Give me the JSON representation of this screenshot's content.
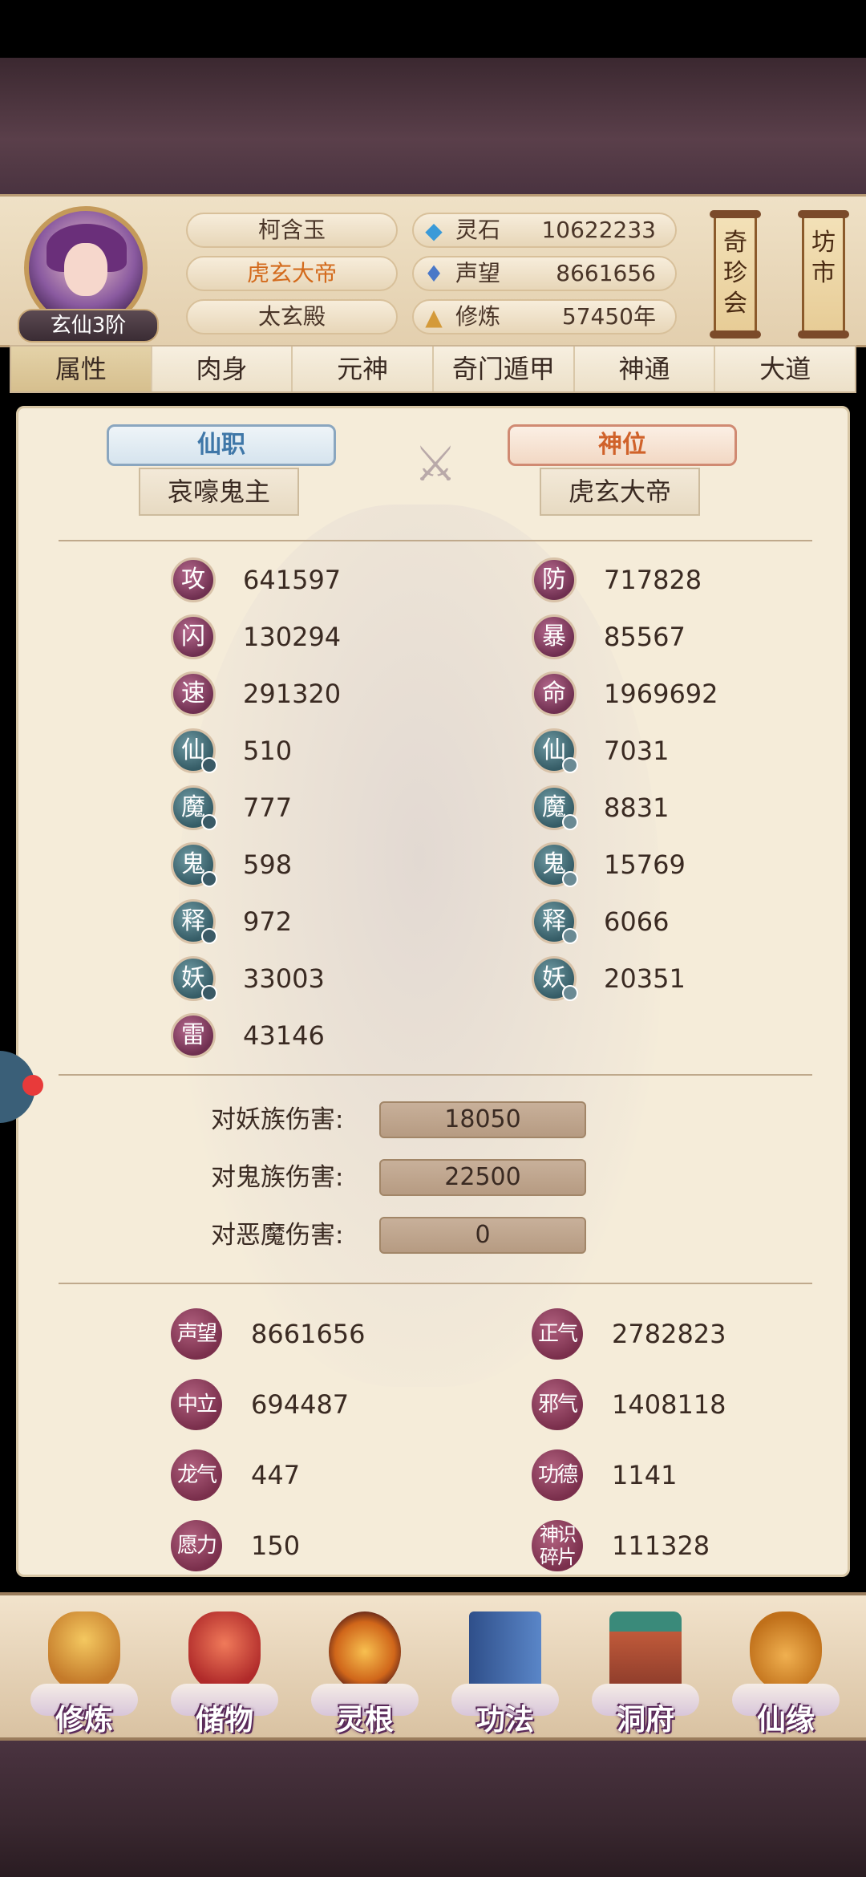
{
  "header": {
    "rank": "玄仙3阶",
    "name": "柯含玉",
    "title": "虎玄大帝",
    "sect": "太玄殿",
    "resources": [
      {
        "icon": "spirit-stone-icon",
        "label": "灵石",
        "value": "10622233"
      },
      {
        "icon": "prestige-crystal-icon",
        "label": "声望",
        "value": "8661656"
      },
      {
        "icon": "meditation-icon",
        "label": "修炼",
        "value": "57450年"
      }
    ],
    "scroll_left": "奇珍会",
    "scroll_right": "坊市"
  },
  "tabs": [
    {
      "label": "属性",
      "active": true
    },
    {
      "label": "肉身"
    },
    {
      "label": "元神"
    },
    {
      "label": "奇门遁甲"
    },
    {
      "label": "神通"
    },
    {
      "label": "大道"
    }
  ],
  "positions": {
    "left_banner": "仙职",
    "left_value": "哀嚎鬼主",
    "right_banner": "神位",
    "right_value": "虎玄大帝"
  },
  "stats_left": [
    {
      "glyph": "攻",
      "value": "641597"
    },
    {
      "glyph": "闪",
      "value": "130294"
    },
    {
      "glyph": "速",
      "value": "291320"
    },
    {
      "glyph": "仙",
      "value": "510"
    },
    {
      "glyph": "魔",
      "value": "777"
    },
    {
      "glyph": "鬼",
      "value": "598"
    },
    {
      "glyph": "释",
      "value": "972"
    },
    {
      "glyph": "妖",
      "value": "33003"
    },
    {
      "glyph": "雷",
      "value": "43146"
    }
  ],
  "stats_right": [
    {
      "glyph": "防",
      "value": "717828"
    },
    {
      "glyph": "暴",
      "value": "85567"
    },
    {
      "glyph": "命",
      "value": "1969692"
    },
    {
      "glyph": "仙",
      "value": "7031"
    },
    {
      "glyph": "魔",
      "value": "8831"
    },
    {
      "glyph": "鬼",
      "value": "15769"
    },
    {
      "glyph": "释",
      "value": "6066"
    },
    {
      "glyph": "妖",
      "value": "20351"
    }
  ],
  "damage": [
    {
      "label": "对妖族伤害:",
      "value": "18050"
    },
    {
      "label": "对鬼族伤害:",
      "value": "22500"
    },
    {
      "label": "对恶魔伤害:",
      "value": "0"
    }
  ],
  "misc_left": [
    {
      "glyph": "声望",
      "value": "8661656"
    },
    {
      "glyph": "中立",
      "value": "694487"
    },
    {
      "glyph": "龙气",
      "value": "447"
    },
    {
      "glyph": "愿力",
      "value": "150"
    }
  ],
  "misc_right": [
    {
      "glyph": "正气",
      "value": "2782823"
    },
    {
      "glyph": "邪气",
      "value": "1408118"
    },
    {
      "glyph": "功德",
      "value": "1141"
    },
    {
      "glyph": "神识碎片",
      "value": "111328"
    }
  ],
  "nav": [
    {
      "label": "修炼",
      "icon": "meditation-icon",
      "color": "#e0a040"
    },
    {
      "label": "储物",
      "icon": "storage-bag-icon",
      "color": "#d0482e"
    },
    {
      "label": "灵根",
      "icon": "spirit-root-icon",
      "color": "#e07a18"
    },
    {
      "label": "功法",
      "icon": "book-icon",
      "color": "#3f6aa8"
    },
    {
      "label": "洞府",
      "icon": "cave-house-icon",
      "color": "#b0503a"
    },
    {
      "label": "仙缘",
      "icon": "gourd-icon",
      "color": "#d08a2a"
    }
  ],
  "colors": {
    "accent_orange": "#d36a1c",
    "accent_blue": "#3f77a8"
  }
}
